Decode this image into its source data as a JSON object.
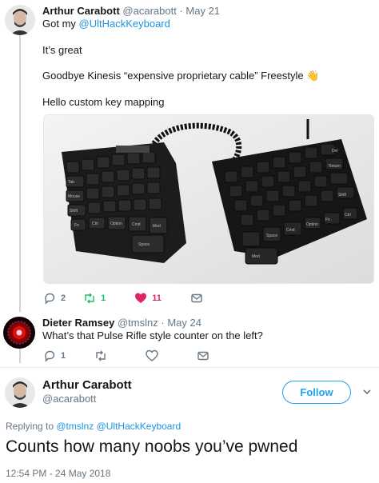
{
  "tweet1": {
    "name": "Arthur Carabott",
    "handle": "@acarabott",
    "separator": "·",
    "date": "May 21",
    "line1_prefix": "Got my ",
    "line1_mention": "@UltHackKeyboard",
    "line2": "It’s great",
    "line3": "Goodbye Kinesis “expensive proprietary cable” Freestyle 👋",
    "line4": "Hello custom key mapping",
    "photo_alt": "Photo of a black split ergonomic keyboard with coiled cable",
    "keycaps": {
      "tab": "Tab",
      "mouse": "Mouse",
      "shift": "Shift",
      "fn": "Fn",
      "ctrl": "Ctrl",
      "option": "Option",
      "cmd": "Cmd",
      "mod": "Mod",
      "space": "Space",
      "return": "Return",
      "del": "Del"
    },
    "replies": "2",
    "retweets": "1",
    "likes": "11"
  },
  "tweet2": {
    "name": "Dieter Ramsey",
    "handle": "@tmslnz",
    "separator": "·",
    "date": "May 24",
    "text": "What’s that Pulse Rifle style counter on the left?",
    "replies": "1"
  },
  "main": {
    "name": "Arthur Carabott",
    "handle": "@acarabott",
    "follow_label": "Follow",
    "reply_prefix": "Replying to ",
    "reply_mention1": "@tmslnz",
    "reply_mention2": "@UltHackKeyboard",
    "text": "Counts how many noobs you’ve pwned",
    "timestamp": "12:54 PM - 24 May 2018"
  },
  "colors": {
    "accent": "#1da1f2",
    "like": "#e0245e",
    "retweet": "#17bf63",
    "muted": "#657786"
  },
  "icons": {
    "reply": "reply-icon",
    "retweet": "retweet-icon",
    "like": "heart-icon",
    "dm": "envelope-icon",
    "caret": "chevron-down-icon"
  }
}
